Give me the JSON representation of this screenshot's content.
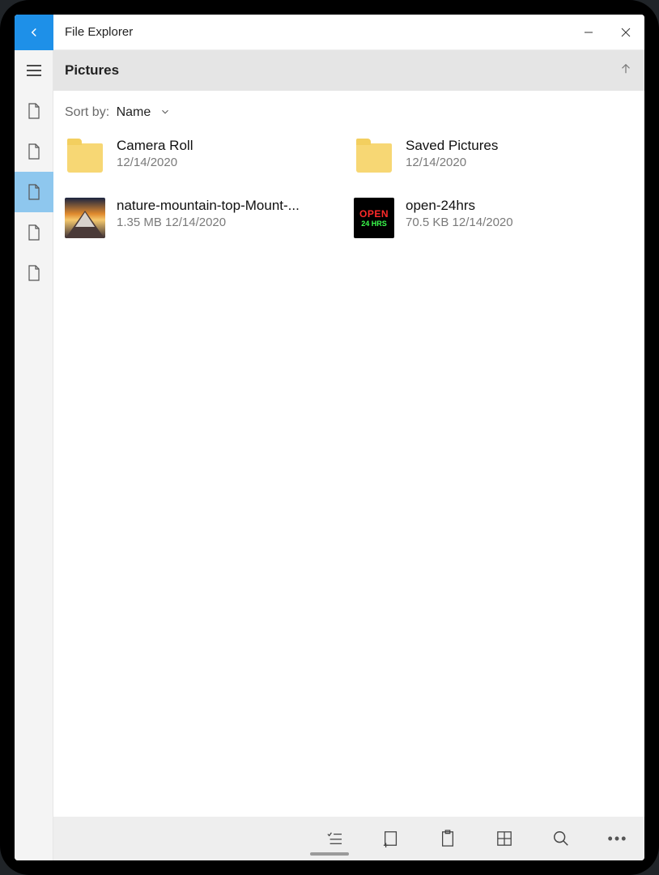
{
  "title": "File Explorer",
  "breadcrumb": "Pictures",
  "sort": {
    "label": "Sort by:",
    "value": "Name"
  },
  "items": [
    {
      "name": "Camera Roll",
      "sub": "12/14/2020",
      "kind": "folder"
    },
    {
      "name": "Saved Pictures",
      "sub": "12/14/2020",
      "kind": "folder"
    },
    {
      "name": "nature-mountain-top-Mount-...",
      "sub": "1.35 MB 12/14/2020",
      "kind": "image-mountain"
    },
    {
      "name": "open-24hrs",
      "sub": "70.5 KB 12/14/2020",
      "kind": "image-open24"
    }
  ],
  "thumbs": {
    "open24": {
      "line1": "OPEN",
      "line2": "24 HRS"
    }
  }
}
